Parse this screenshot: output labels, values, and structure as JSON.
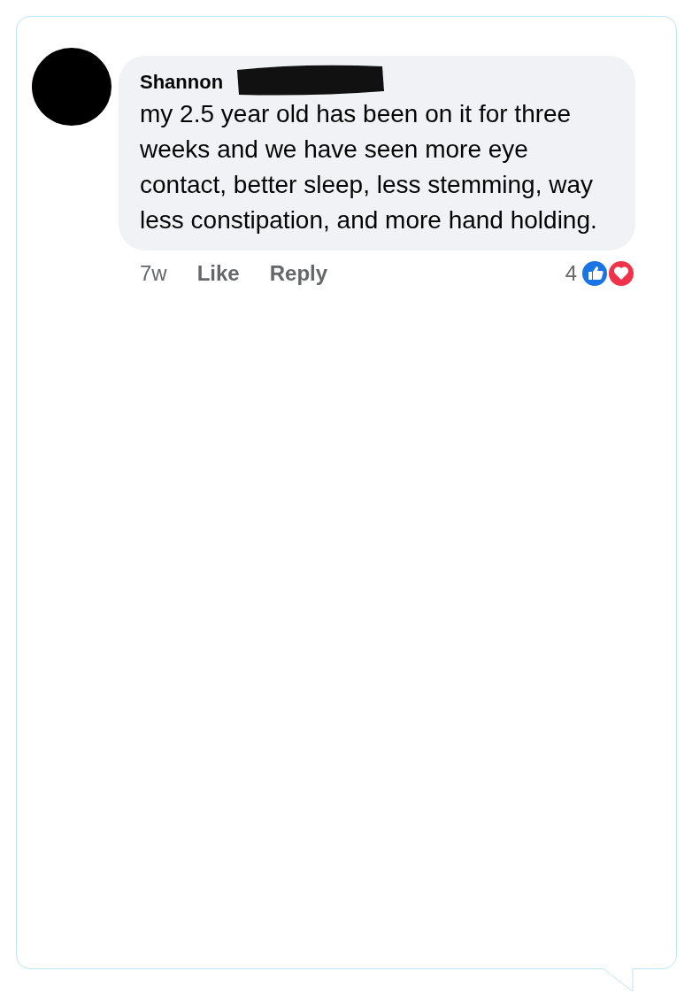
{
  "comment": {
    "author": "Shannon",
    "text": "my 2.5 year old has been on it for three weeks and we have seen more eye contact, better sleep, less stemming, way less constipation, and more hand holding.",
    "time": "7w",
    "actions": [
      "Like",
      "Reply"
    ],
    "reaction_count": "4"
  }
}
